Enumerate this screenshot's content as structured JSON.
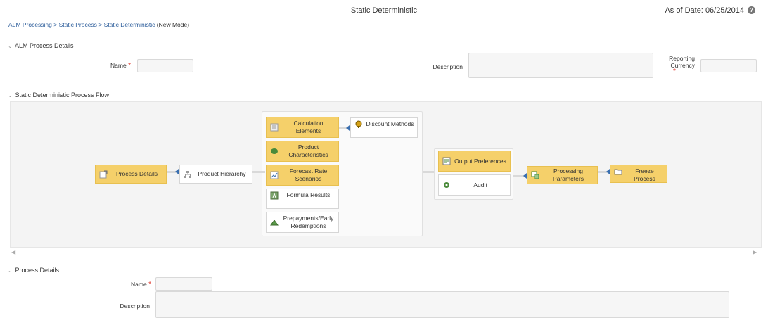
{
  "header": {
    "title": "Static Deterministic",
    "as_of_label": "As of Date:",
    "as_of_value": "06/25/2014"
  },
  "breadcrumb": {
    "items": [
      "ALM Processing",
      "Static Process",
      "Static Deterministic"
    ],
    "separator": ">",
    "mode": "(New Mode)"
  },
  "alm_process_details": {
    "header": "ALM Process Details",
    "name_label": "Name",
    "name_value": "",
    "description_label": "Description",
    "description_value": "",
    "reporting_currency_label_line1": "Reporting",
    "reporting_currency_label_line2": "Currency",
    "reporting_currency_value": ""
  },
  "process_flow": {
    "header": "Static Deterministic Process Flow",
    "nodes": {
      "process_details": "Process Details",
      "product_hierarchy": "Product Hierarchy",
      "calculation_elements": "Calculation Elements",
      "discount_methods": "Discount Methods",
      "product_characteristics": "Product Characteristics",
      "forecast_rate_scenarios": "Forecast Rate Scenarios",
      "formula_results": "Formula Results",
      "prepayments": "Prepayments/Early Redemptions",
      "output_preferences": "Output Preferences",
      "audit": "Audit",
      "processing_parameters": "Processing Parameters",
      "freeze_process": "Freeze Process"
    }
  },
  "process_details_form": {
    "header": "Process Details",
    "name_label": "Name",
    "name_value": "",
    "description_label": "Description",
    "description_value": ""
  },
  "colors": {
    "highlight": "#f5d06a",
    "link": "#2b5c9a",
    "required": "#e03c31",
    "arrow": "#3a6fb0"
  }
}
